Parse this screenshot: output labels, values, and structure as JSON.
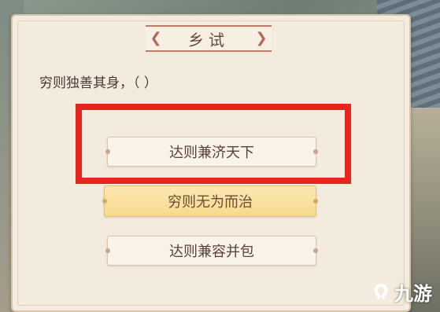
{
  "quiz": {
    "title": "乡试",
    "question": "穷则独善其身，（    ）",
    "options": [
      {
        "label": "达则兼济天下",
        "state": "highlighted-by-frame"
      },
      {
        "label": "穷则无为而治",
        "state": "selected-gold"
      },
      {
        "label": "达则兼容并包",
        "state": "normal"
      }
    ]
  },
  "watermark": {
    "text": "九游",
    "icon": "jiuyou-logo-icon"
  },
  "colors": {
    "card_bg": "#f3ebdd",
    "highlight_frame": "#e8251c",
    "gold_option": "#f6d98d",
    "title_accent": "#b06a55"
  }
}
